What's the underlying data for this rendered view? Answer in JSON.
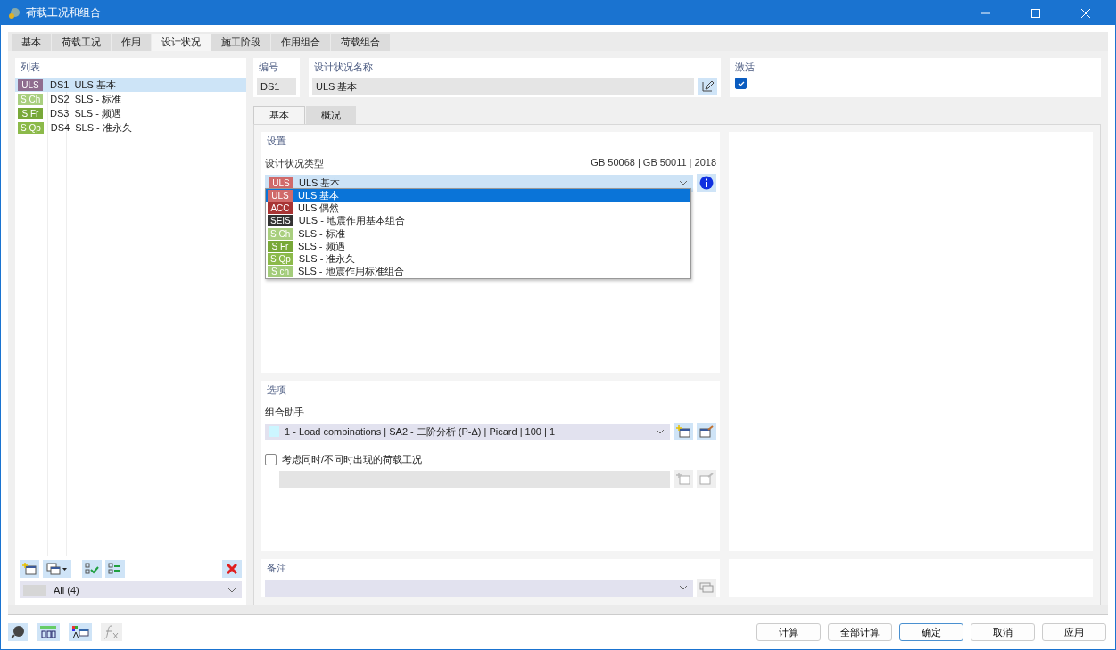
{
  "window": {
    "title": "荷载工况和组合"
  },
  "tabs": [
    {
      "label": "基本",
      "selected": false
    },
    {
      "label": "荷载工况",
      "selected": false
    },
    {
      "label": "作用",
      "selected": false
    },
    {
      "label": "设计状况",
      "selected": true
    },
    {
      "label": "施工阶段",
      "selected": false
    },
    {
      "label": "作用组合",
      "selected": false
    },
    {
      "label": "荷载组合",
      "selected": false
    }
  ],
  "list": {
    "title": "列表",
    "items": [
      {
        "tag": "ULS",
        "color": "#8f6d8f",
        "id": "DS1",
        "name": "ULS 基本",
        "selected": true
      },
      {
        "tag": "S Ch",
        "color": "#a9cf7f",
        "id": "DS2",
        "name": "SLS - 标准",
        "selected": false
      },
      {
        "tag": "S Fr",
        "color": "#78a838",
        "id": "DS3",
        "name": "SLS - 频遇",
        "selected": false
      },
      {
        "tag": "S Qp",
        "color": "#8cba4a",
        "id": "DS4",
        "name": "SLS - 准永久",
        "selected": false
      }
    ],
    "filter": {
      "value": "All (4)"
    }
  },
  "number": {
    "label": "编号",
    "value": "DS1"
  },
  "name": {
    "label": "设计状况名称",
    "value": "ULS 基本"
  },
  "activate": {
    "label": "激活",
    "checked": true
  },
  "subtabs": [
    {
      "label": "基本",
      "selected": true
    },
    {
      "label": "概况",
      "selected": false
    }
  ],
  "settings": {
    "title": "设置",
    "type_label": "设计状况类型",
    "standard": "GB 50068 | GB 50011 | 2018",
    "type_select": {
      "tag": "ULS",
      "color": "#d06a6a",
      "value": "ULS 基本"
    },
    "dropdown": [
      {
        "tag": "ULS",
        "color": "#d06a6a",
        "label": "ULS 基本",
        "selected": true
      },
      {
        "tag": "ACC",
        "color": "#a83434",
        "label": "ULS 偶然",
        "selected": false
      },
      {
        "tag": "SEIS",
        "color": "#333333",
        "label": "ULS - 地震作用基本组合",
        "selected": false
      },
      {
        "tag": "S Ch",
        "color": "#a9cf7f",
        "label": "SLS - 标准",
        "selected": false
      },
      {
        "tag": "S Fr",
        "color": "#78a838",
        "label": "SLS - 频遇",
        "selected": false
      },
      {
        "tag": "S Qp",
        "color": "#8cba4a",
        "label": "SLS - 准永久",
        "selected": false
      },
      {
        "tag": "S ch",
        "color": "#a3cc7a",
        "label": "SLS - 地震作用标准组合",
        "selected": false
      }
    ]
  },
  "options": {
    "title": "选项",
    "assistant_label": "组合助手",
    "assistant_value": "1 - Load combinations | SA2 - 二阶分析 (P-Δ) | Picard | 100 | 1",
    "consider": {
      "label": "考虑同时/不同时出现的荷载工况",
      "checked": false
    }
  },
  "notes": {
    "title": "备注"
  },
  "buttons": [
    {
      "label": "计算",
      "selected": false
    },
    {
      "label": "全部计算",
      "selected": false
    },
    {
      "label": "确定",
      "selected": true
    },
    {
      "label": "取消",
      "selected": false
    },
    {
      "label": "应用",
      "selected": false
    }
  ]
}
